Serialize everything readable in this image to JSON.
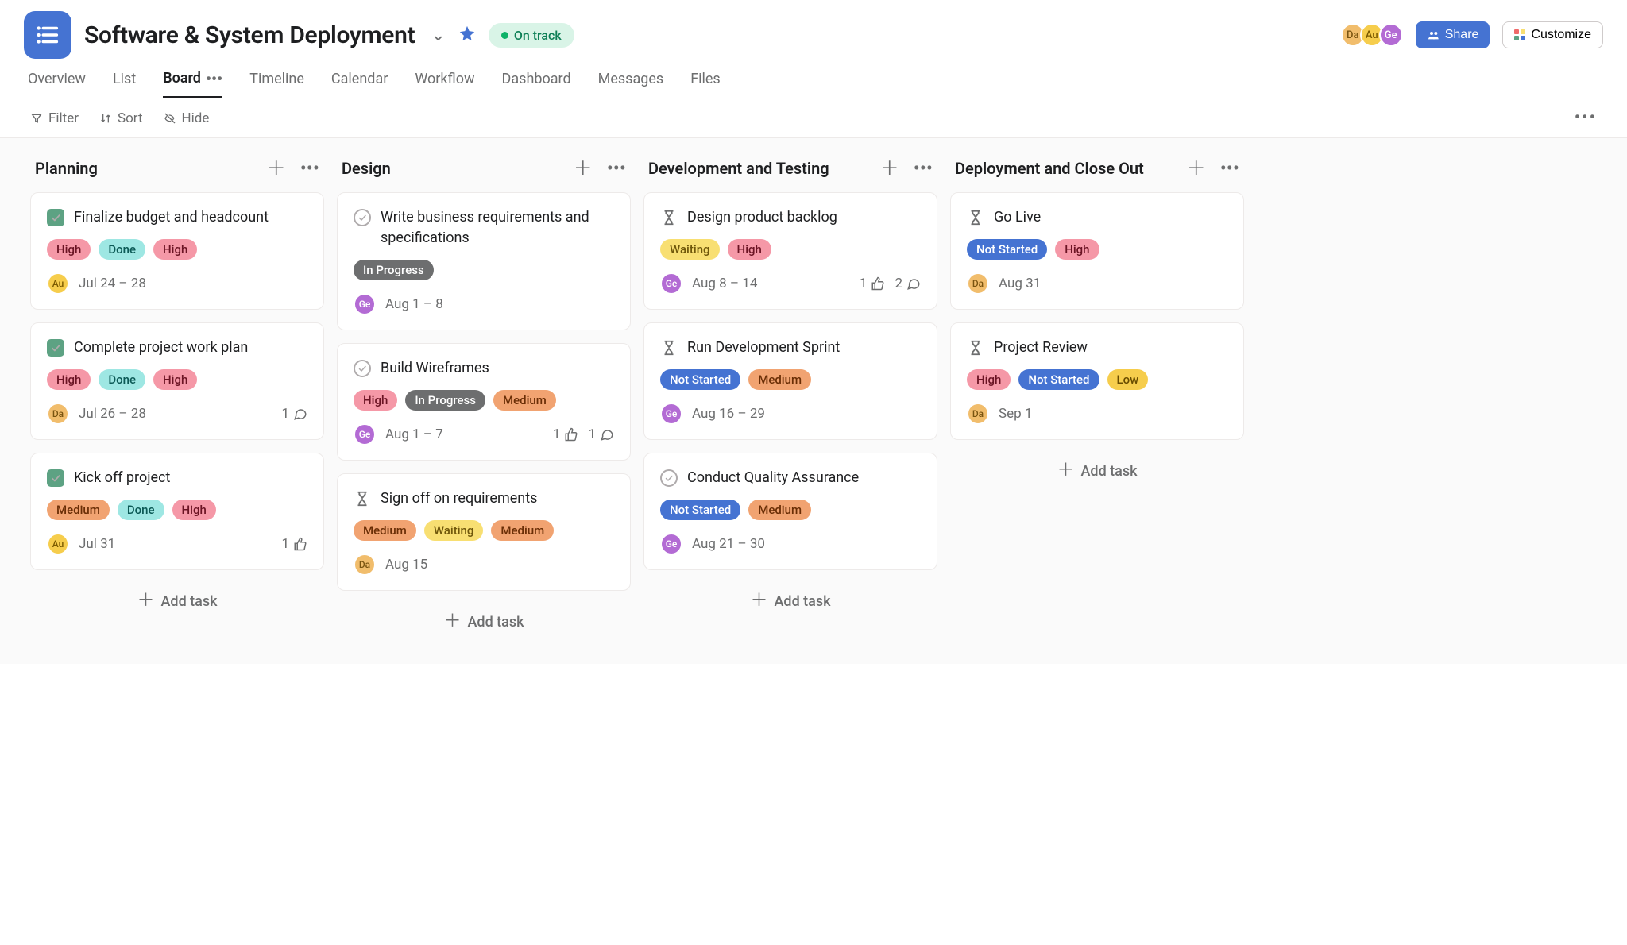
{
  "header": {
    "title": "Software & System Deployment",
    "status": "On track",
    "share": "Share",
    "customize": "Customize",
    "avatars": [
      {
        "initials": "Da",
        "cls": "da"
      },
      {
        "initials": "Au",
        "cls": "au"
      },
      {
        "initials": "Ge",
        "cls": "ge"
      }
    ]
  },
  "tabs": [
    "Overview",
    "List",
    "Board",
    "Timeline",
    "Calendar",
    "Workflow",
    "Dashboard",
    "Messages",
    "Files"
  ],
  "toolbar": {
    "filter": "Filter",
    "sort": "Sort",
    "hide": "Hide"
  },
  "columns": [
    {
      "title": "Planning",
      "addTask": "Add task",
      "cards": [
        {
          "icon": "done",
          "title": "Finalize budget and headcount",
          "tags": [
            {
              "t": "High",
              "c": "high"
            },
            {
              "t": "Done",
              "c": "done"
            },
            {
              "t": "High",
              "c": "high"
            }
          ],
          "assignee": {
            "initials": "Au",
            "cls": "au"
          },
          "date": "Jul 24 – 28"
        },
        {
          "icon": "done",
          "title": "Complete project work plan",
          "tags": [
            {
              "t": "High",
              "c": "high"
            },
            {
              "t": "Done",
              "c": "done"
            },
            {
              "t": "High",
              "c": "high"
            }
          ],
          "assignee": {
            "initials": "Da",
            "cls": "da"
          },
          "date": "Jul 26 – 28",
          "comments": 1
        },
        {
          "icon": "done",
          "title": "Kick off project",
          "tags": [
            {
              "t": "Medium",
              "c": "medium"
            },
            {
              "t": "Done",
              "c": "done"
            },
            {
              "t": "High",
              "c": "high"
            }
          ],
          "assignee": {
            "initials": "Au",
            "cls": "au"
          },
          "date": "Jul 31",
          "likes": 1
        }
      ]
    },
    {
      "title": "Design",
      "addTask": "Add task",
      "cards": [
        {
          "icon": "check",
          "title": "Write business requirements and specifications",
          "tags": [
            {
              "t": "In Progress",
              "c": "inprogress"
            }
          ],
          "assignee": {
            "initials": "Ge",
            "cls": "ge"
          },
          "date": "Aug 1 – 8"
        },
        {
          "icon": "check",
          "title": "Build Wireframes",
          "tags": [
            {
              "t": "High",
              "c": "high"
            },
            {
              "t": "In Progress",
              "c": "inprogress"
            },
            {
              "t": "Medium",
              "c": "medium"
            }
          ],
          "assignee": {
            "initials": "Ge",
            "cls": "ge"
          },
          "date": "Aug 1 – 7",
          "likes": 1,
          "comments": 1
        },
        {
          "icon": "hourglass",
          "title": "Sign off on requirements",
          "tags": [
            {
              "t": "Medium",
              "c": "medium"
            },
            {
              "t": "Waiting",
              "c": "waiting"
            },
            {
              "t": "Medium",
              "c": "medium"
            }
          ],
          "assignee": {
            "initials": "Da",
            "cls": "da"
          },
          "date": "Aug 15"
        }
      ]
    },
    {
      "title": "Development and Testing",
      "addTask": "Add task",
      "cards": [
        {
          "icon": "hourglass",
          "title": "Design product backlog",
          "tags": [
            {
              "t": "Waiting",
              "c": "waiting"
            },
            {
              "t": "High",
              "c": "high"
            }
          ],
          "assignee": {
            "initials": "Ge",
            "cls": "ge"
          },
          "date": "Aug 8 – 14",
          "likes": 1,
          "comments": 2
        },
        {
          "icon": "hourglass",
          "title": "Run Development Sprint",
          "tags": [
            {
              "t": "Not Started",
              "c": "notstarted"
            },
            {
              "t": "Medium",
              "c": "medium"
            }
          ],
          "assignee": {
            "initials": "Ge",
            "cls": "ge"
          },
          "date": "Aug 16 – 29"
        },
        {
          "icon": "check",
          "title": "Conduct Quality Assurance",
          "tags": [
            {
              "t": "Not Started",
              "c": "notstarted"
            },
            {
              "t": "Medium",
              "c": "medium"
            }
          ],
          "assignee": {
            "initials": "Ge",
            "cls": "ge"
          },
          "date": "Aug 21 – 30"
        }
      ]
    },
    {
      "title": "Deployment and Close Out",
      "addTask": "Add task",
      "cards": [
        {
          "icon": "hourglass",
          "title": "Go Live",
          "tags": [
            {
              "t": "Not Started",
              "c": "notstarted"
            },
            {
              "t": "High",
              "c": "high"
            }
          ],
          "assignee": {
            "initials": "Da",
            "cls": "da"
          },
          "date": "Aug 31"
        },
        {
          "icon": "hourglass",
          "title": "Project Review",
          "tags": [
            {
              "t": "High",
              "c": "high"
            },
            {
              "t": "Not Started",
              "c": "notstarted"
            },
            {
              "t": "Low",
              "c": "low"
            }
          ],
          "assignee": {
            "initials": "Da",
            "cls": "da"
          },
          "date": "Sep 1"
        }
      ]
    }
  ]
}
